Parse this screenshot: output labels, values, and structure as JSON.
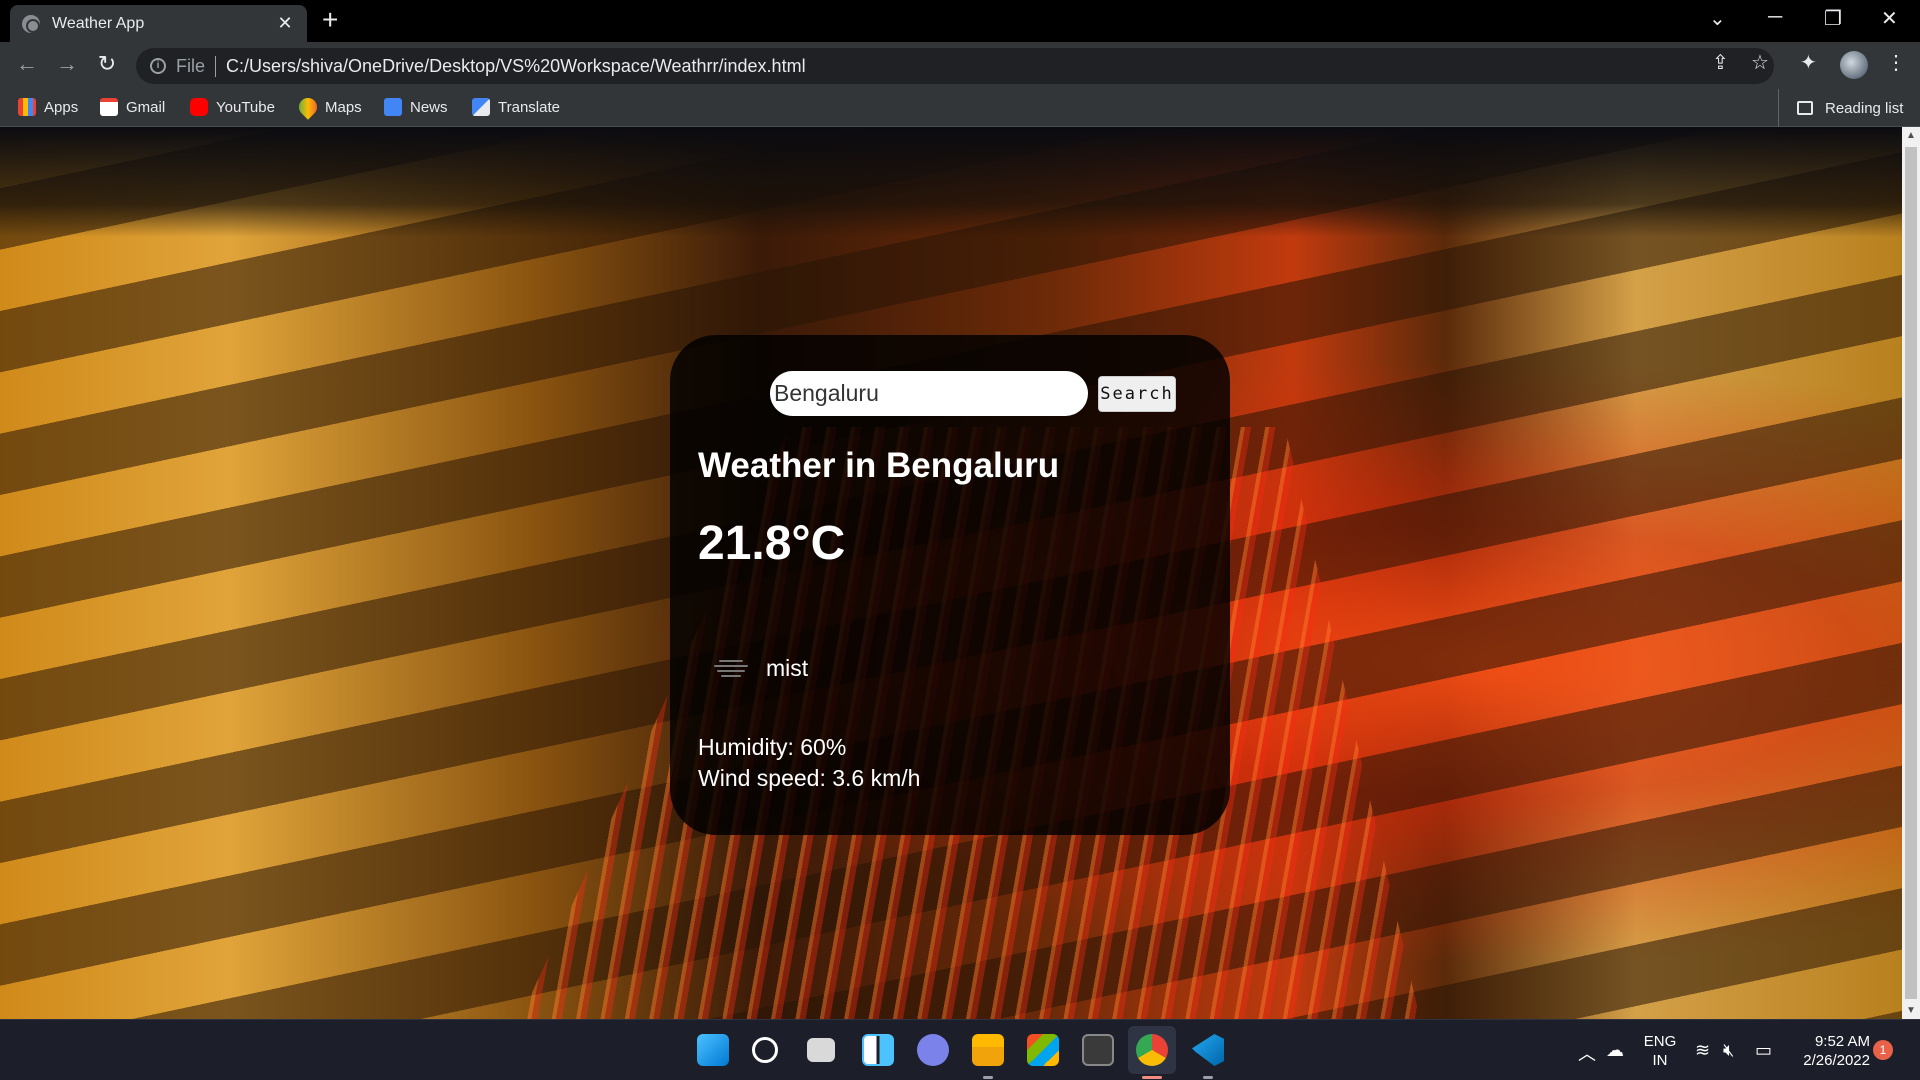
{
  "browser": {
    "tab_title": "Weather App",
    "address_scheme": "File",
    "address_url": "C:/Users/shiva/OneDrive/Desktop/VS%20Workspace/Weathrr/index.html",
    "bookmarks": [
      "Apps",
      "Gmail",
      "YouTube",
      "Maps",
      "News",
      "Translate"
    ],
    "reading_list": "Reading list"
  },
  "weather": {
    "search_value": "Bengaluru",
    "search_button": "Search",
    "city_title": "Weather in Bengaluru",
    "temperature": "21.8°C",
    "description": "mist",
    "humidity": "Humidity: 60%",
    "wind": "Wind speed: 3.6 km/h"
  },
  "taskbar": {
    "lang_top": "ENG",
    "lang_bottom": "IN",
    "time": "9:52 AM",
    "date": "2/26/2022",
    "notification_count": "1"
  },
  "colors": {
    "chrome_dark": "#000000",
    "chrome_toolbar": "#323639",
    "card_bg": "rgba(0,0,0,0.82)",
    "taskbar_bg": "#1c1f2a"
  }
}
